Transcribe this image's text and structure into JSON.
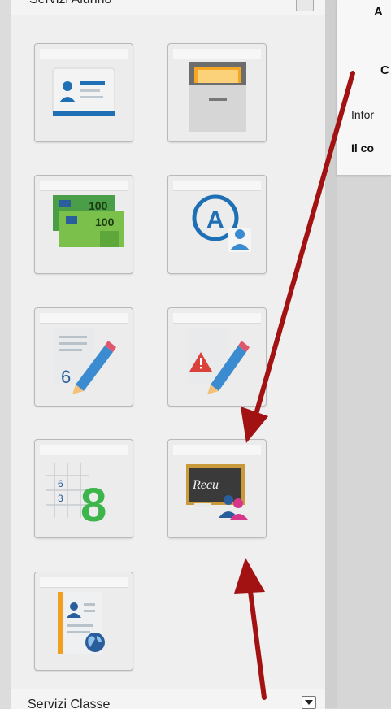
{
  "panel": {
    "header_title": "Servizi Alunno",
    "footer_title": "Servizi Classe",
    "tiles": [
      {
        "icon": "student-id-card-icon"
      },
      {
        "icon": "file-drawer-icon"
      },
      {
        "icon": "money-bills-icon"
      },
      {
        "icon": "absence-student-icon"
      },
      {
        "icon": "grade-pencil-icon"
      },
      {
        "icon": "warning-note-pencil-icon"
      },
      {
        "icon": "gradebook-grid-icon"
      },
      {
        "icon": "recovery-blackboard-icon"
      },
      {
        "icon": "student-profile-globe-icon"
      }
    ]
  },
  "right_panel": {
    "line1": "A",
    "line2": "C",
    "line3": "Infor",
    "line4": "Il co"
  },
  "colors": {
    "arrow": "#a31212",
    "blue_icon": "#1f6fb5",
    "green_number": "#3cb64a",
    "blackboard": "#3a3a3a"
  }
}
